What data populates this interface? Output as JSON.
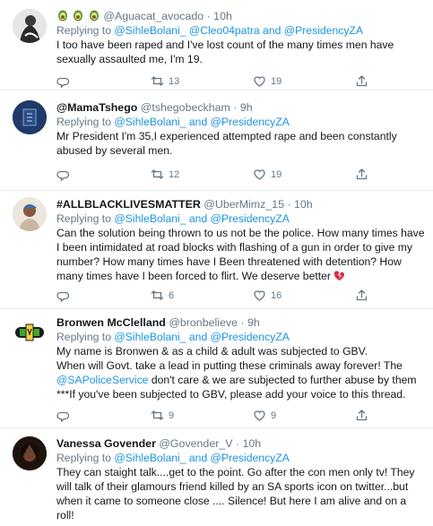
{
  "tweets": [
    {
      "name_emoji": [
        "avocado",
        "avocado",
        "avocado"
      ],
      "name": "",
      "handle": "@Aguacat_avocado",
      "time": "· 10h",
      "reply_prefix": "Replying to",
      "reply_mentions": "@SihleBolani_ @Cleo04patra and @PresidencyZA",
      "text": "I too have been raped and I've lost count of the many times men have sexually assaulted me, I'm 19.",
      "retweets": "13",
      "likes": "19"
    },
    {
      "name": "@MamaTshego",
      "handle": "@tshegobeckham",
      "time": "· 9h",
      "reply_prefix": "Replying to",
      "reply_mentions": "@SihleBolani_ and @PresidencyZA",
      "text": "Mr President I'm 35,I experienced attempted rape and been constantly abused by several men.",
      "retweets": "12",
      "likes": "19"
    },
    {
      "name": "#ALLBLACKLIVESMATTER",
      "handle": "@UberMimz_15",
      "time": "· 10h",
      "reply_prefix": "Replying to",
      "reply_mentions": "@SihleBolani_ and @PresidencyZA",
      "text": "Can the solution being thrown to us not be the police. How many times have I been intimidated at road blocks with flashing of a gun in order to give my number? How many times have I Been threatened with detention? How many times have I been forced to flirt. We deserve  better",
      "text_emoji": "broken-heart",
      "retweets": "6",
      "likes": "16"
    },
    {
      "name": "Bronwen McClelland",
      "handle": "@bronbelieve",
      "time": "· 9h",
      "reply_prefix": "Replying to",
      "reply_mentions": "@SihleBolani_ and @PresidencyZA",
      "text_lines": [
        "My name is Bronwen & as a child & adult was subjected to GBV.",
        "When will Govt. take a lead in putting these criminals away forever! The"
      ],
      "text_mention": "@SAPoliceService",
      "text_after_mention": " don't care & we are subjected to further abuse by them",
      "text_last": "***If you've been subjected to GBV, please add your voice to this thread.",
      "retweets": "9",
      "likes": "9"
    },
    {
      "name": "Vanessa Govender",
      "handle": "@Govender_V",
      "time": "· 10h",
      "reply_prefix": "Replying to",
      "reply_mentions": "@SihleBolani_ and @PresidencyZA",
      "text": "They can staight talk....get to the point. Go after the con men only tv! They will talk of their glamours friend killed by an SA sports icon on twitter...but when it came to someone close .... Silence!  But here I am alive and on a roll!",
      "retweets": "",
      "likes": ""
    }
  ]
}
